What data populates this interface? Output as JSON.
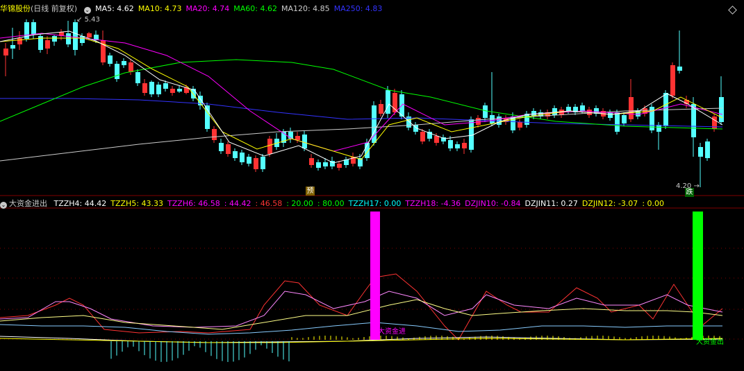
{
  "main_panel": {
    "stock_name": "华锦股份",
    "period": "(日线 前复权)",
    "ma": [
      {
        "label": "MA5:",
        "value": "4.62",
        "color": "#ffffff"
      },
      {
        "label": "MA10:",
        "value": "4.73",
        "color": "#ffff00"
      },
      {
        "label": "MA20:",
        "value": "4.74",
        "color": "#ff00ff"
      },
      {
        "label": "MA60:",
        "value": "4.62",
        "color": "#00ff00"
      },
      {
        "label": "MA120:",
        "value": "4.85",
        "color": "#cccccc"
      },
      {
        "label": "MA250:",
        "value": "4.83",
        "color": "#3333ff"
      }
    ],
    "high_label": "5.43",
    "low_label": "4.20",
    "marker_yu": "预",
    "marker_die": "跌"
  },
  "sub_panel": {
    "indicator_name": "大资金进出",
    "items": [
      {
        "text": "TZZH4: 44.42",
        "color": "#ffffff"
      },
      {
        "text": "TZZH5: 43.33",
        "color": "#ffff00"
      },
      {
        "text": "TZZH6: 46.58",
        "color": "#ff00ff"
      },
      {
        "text": ": 44.42",
        "color": "#ff00ff"
      },
      {
        "text": ": 46.58",
        "color": "#ff3333"
      },
      {
        "text": ": 20.00",
        "color": "#00ff00"
      },
      {
        "text": ": 80.00",
        "color": "#00ff00"
      },
      {
        "text": "TZZH17: 0.00",
        "color": "#00ffff"
      },
      {
        "text": "TZZH18: -4.36",
        "color": "#ff00ff"
      },
      {
        "text": "DZJIN10: -0.84",
        "color": "#ff00ff"
      },
      {
        "text": "DZJIN11: 0.27",
        "color": "#ffffff"
      },
      {
        "text": "DZJIN12: -3.07",
        "color": "#ffff00"
      },
      {
        "text": ": 0.00",
        "color": "#ffff00"
      }
    ],
    "signal_in": "大资金进",
    "signal_out": "大资金出"
  },
  "colors": {
    "up": "#ff3333",
    "down": "#54ffff",
    "grid": "#800000"
  }
}
